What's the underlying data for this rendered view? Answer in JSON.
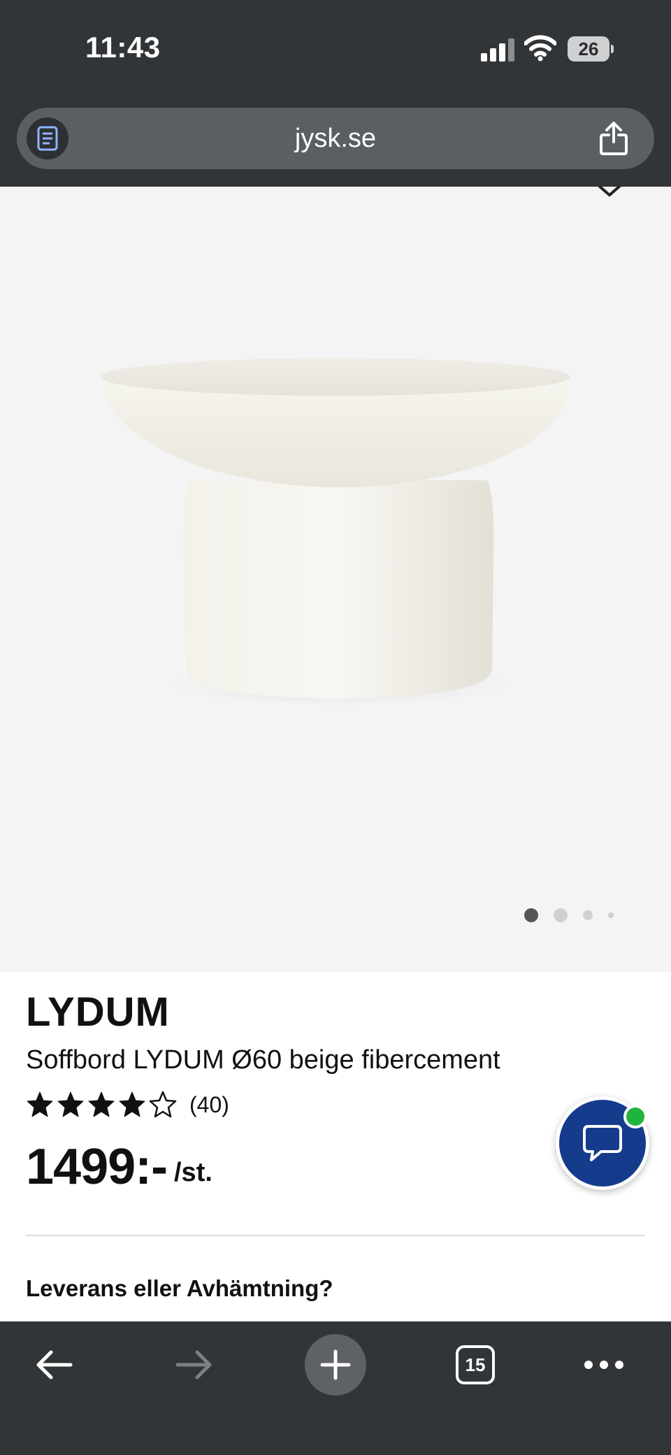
{
  "status_bar": {
    "time": "11:43",
    "battery_level": "26"
  },
  "address_bar": {
    "url": "jysk.se"
  },
  "gallery": {
    "image_count": 4,
    "active_index": 0,
    "background_color": "#f4f4f4"
  },
  "product": {
    "brand": "LYDUM",
    "subtitle": "Soffbord LYDUM Ø60 beige fibercement",
    "rating": 4,
    "rating_max": 5,
    "review_count": "(40)",
    "price": "1499:-",
    "unit": "/st."
  },
  "delivery": {
    "title": "Leverans eller Avhämtning?"
  },
  "chat": {
    "icon": "chat-bubble-icon",
    "status_color": "#1fb53c",
    "button_color": "#143b8c"
  },
  "toolbar": {
    "tab_count": "15",
    "icons": [
      "back-arrow-icon",
      "forward-arrow-icon",
      "plus-icon",
      "tabs-icon",
      "more-icon"
    ]
  }
}
